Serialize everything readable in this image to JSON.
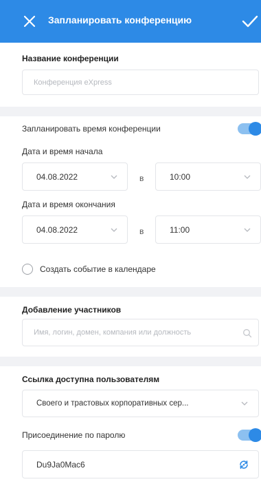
{
  "header": {
    "title": "Запланировать конференцию",
    "color": "#2d8ae6"
  },
  "name_section": {
    "label": "Название конференции",
    "placeholder": "Конференция eXpress"
  },
  "schedule": {
    "toggle_label": "Запланировать время конференции",
    "toggle_on": true,
    "start_label": "Дата и время начала",
    "start_date": "04.08.2022",
    "connector": "в",
    "start_time": "10:00",
    "end_label": "Дата и время окончания",
    "end_date": "04.08.2022",
    "end_time": "11:00",
    "calendar_label": "Создать событие в календаре",
    "calendar_checked": false
  },
  "participants": {
    "label": "Добавление участников",
    "placeholder": "Имя, логин, домен, компания или должность"
  },
  "access": {
    "label": "Ссылка доступна пользователям",
    "selected": "Своего и трастовых корпоративных сер...",
    "password_label": "Присоединение по паролю",
    "password_on": true,
    "password_value": "Du9Ja0Mac6"
  }
}
